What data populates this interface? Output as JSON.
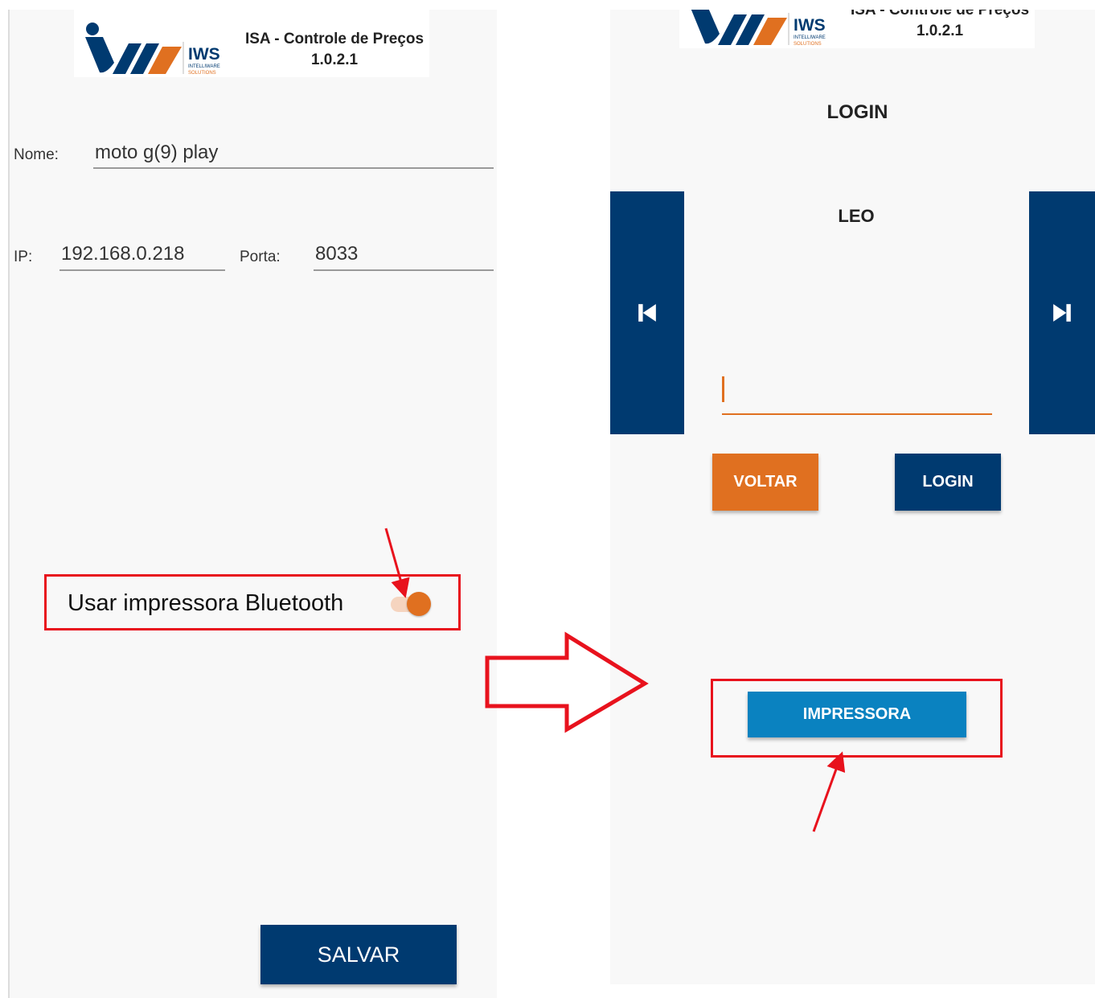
{
  "left_screen": {
    "header": {
      "logo_text": "IWS",
      "logo_subtext_1": "INTELLIWARE",
      "logo_subtext_2": "SOLUTIONS",
      "app_title": "ISA - Controle de Preços",
      "version": "1.0.2.1"
    },
    "form": {
      "name_label": "Nome:",
      "name_value": "moto g(9) play",
      "ip_label": "IP:",
      "ip_value": "192.168.0.218",
      "port_label": "Porta:",
      "port_value": "8033"
    },
    "bluetooth_switch": {
      "label": "Usar impressora Bluetooth",
      "checked": true
    },
    "save_button_label": "SALVAR"
  },
  "right_screen": {
    "header": {
      "logo_text": "IWS",
      "logo_subtext_1": "INTELLIWARE",
      "logo_subtext_2": "SOLUTIONS",
      "app_title": "ISA - Controle de Preços",
      "version": "1.0.2.1"
    },
    "login_title": "LOGIN",
    "user_name": "LEO",
    "password_value": "",
    "back_button_label": "VOLTAR",
    "login_button_label": "LOGIN",
    "printer_button_label": "IMPRESSORA",
    "prev_icon": "skip-previous-icon",
    "next_icon": "skip-next-icon"
  },
  "colors": {
    "navy": "#003a70",
    "orange": "#e07020",
    "blue": "#0a82c0",
    "annotation_red": "#e8121d",
    "screen_bg": "#f8f8f8"
  }
}
